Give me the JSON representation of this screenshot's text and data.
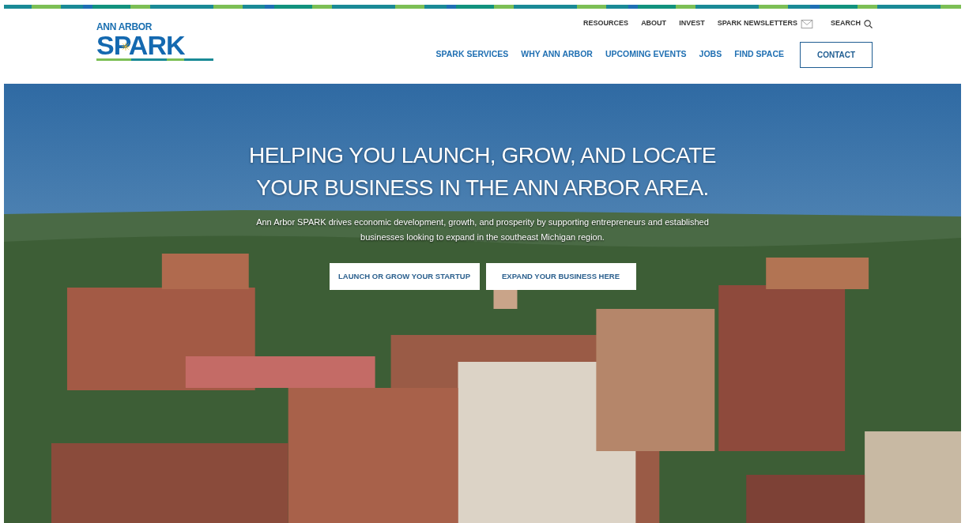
{
  "logo": {
    "small": "ANN ARBOR",
    "big": "SPARK"
  },
  "utility_nav": [
    {
      "label": "RESOURCES",
      "kind": "link"
    },
    {
      "label": "ABOUT",
      "kind": "link"
    },
    {
      "label": "INVEST",
      "kind": "link"
    },
    {
      "label": "SPARK NEWSLETTERS",
      "kind": "mail"
    },
    {
      "label": "SEARCH",
      "kind": "search"
    }
  ],
  "main_nav": [
    {
      "label": "SPARK SERVICES",
      "kind": "link"
    },
    {
      "label": "WHY ANN ARBOR",
      "kind": "link"
    },
    {
      "label": "UPCOMING EVENTS",
      "kind": "link"
    },
    {
      "label": "JOBS",
      "kind": "link"
    },
    {
      "label": "FIND SPACE",
      "kind": "link"
    },
    {
      "label": "CONTACT",
      "kind": "button"
    }
  ],
  "hero": {
    "heading": "HELPING YOU LAUNCH, GROW, AND LOCATE YOUR BUSINESS IN THE ANN ARBOR AREA.",
    "text": "Ann Arbor SPARK drives economic development, growth, and prosperity by supporting entrepreneurs and established businesses looking to expand in the southeast Michigan region.",
    "buttons": [
      "LAUNCH OR GROW YOUR STARTUP",
      "EXPAND YOUR BUSINESS HERE"
    ]
  }
}
